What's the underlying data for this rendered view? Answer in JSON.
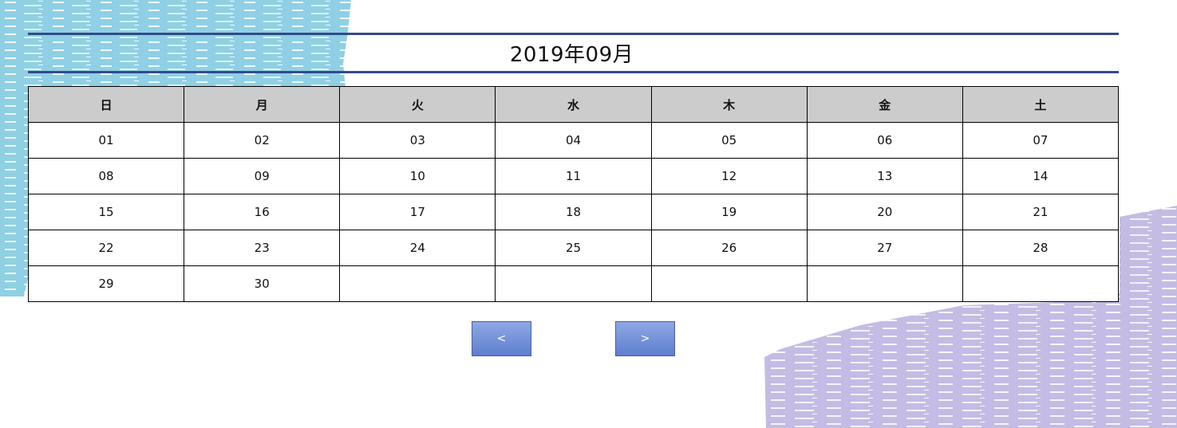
{
  "calendar": {
    "title": "2019年09月",
    "weekdays": [
      "日",
      "月",
      "火",
      "水",
      "木",
      "金",
      "土"
    ],
    "weeks": [
      [
        "01",
        "02",
        "03",
        "04",
        "05",
        "06",
        "07"
      ],
      [
        "08",
        "09",
        "10",
        "11",
        "12",
        "13",
        "14"
      ],
      [
        "15",
        "16",
        "17",
        "18",
        "19",
        "20",
        "21"
      ],
      [
        "22",
        "23",
        "24",
        "25",
        "26",
        "27",
        "28"
      ],
      [
        "29",
        "30",
        "",
        "",
        "",
        "",
        ""
      ]
    ]
  },
  "nav": {
    "prev_label": "<",
    "next_label": ">"
  },
  "colors": {
    "title_rule": "#334a8c",
    "header_bg": "#cccccc",
    "button_gradient_top": "#8fa8e4",
    "button_gradient_bottom": "#5e7fcf",
    "decor_blue": "#8fd0e4",
    "decor_purple": "#c4bce4"
  }
}
